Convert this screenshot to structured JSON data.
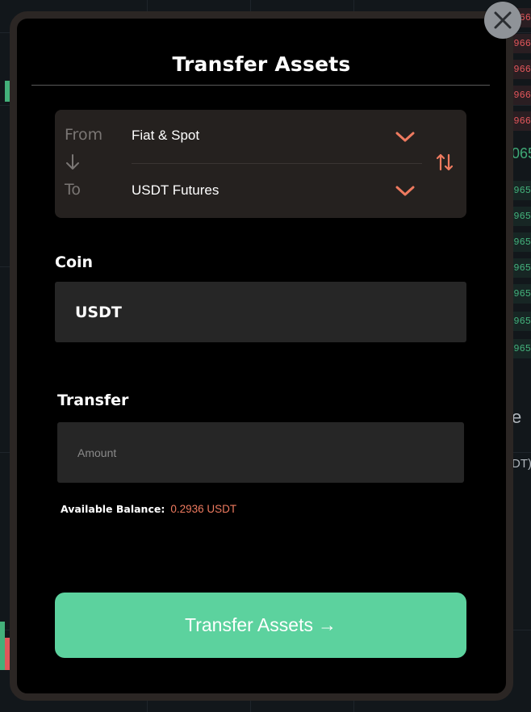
{
  "background": {
    "orderbook_asks": [
      "966",
      "966",
      "966",
      "966"
    ],
    "ticker": "065",
    "orderbook_bids": [
      "965",
      "965",
      "965",
      "965",
      "965",
      "965",
      "965"
    ],
    "side_heading": "e",
    "side_unit": "DT)"
  },
  "modal": {
    "title": "Transfer Assets",
    "close_label": "×",
    "from": {
      "label": "From",
      "value": "Fiat & Spot"
    },
    "to": {
      "label": "To",
      "value": "USDT Futures"
    },
    "coin": {
      "label": "Coin",
      "value": "USDT"
    },
    "transfer": {
      "label": "Transfer",
      "amount_placeholder": "Amount",
      "amount_value": ""
    },
    "balance": {
      "label": "Available Balance:",
      "value": "0.2936 USDT"
    },
    "submit_label": "Transfer Assets",
    "submit_arrow": "→"
  },
  "colors": {
    "accent": "#ee7a5f",
    "button": "#5cd29e",
    "modal_bg": "#000000",
    "field_bg": "#262626",
    "transfer_box_bg": "#25211f"
  },
  "icons": {
    "close": "close-icon",
    "chevron": "chevron-down-icon",
    "swap": "swap-vertical-icon",
    "arrow_down": "arrow-down-icon",
    "submit_arrow": "arrow-right-icon"
  }
}
